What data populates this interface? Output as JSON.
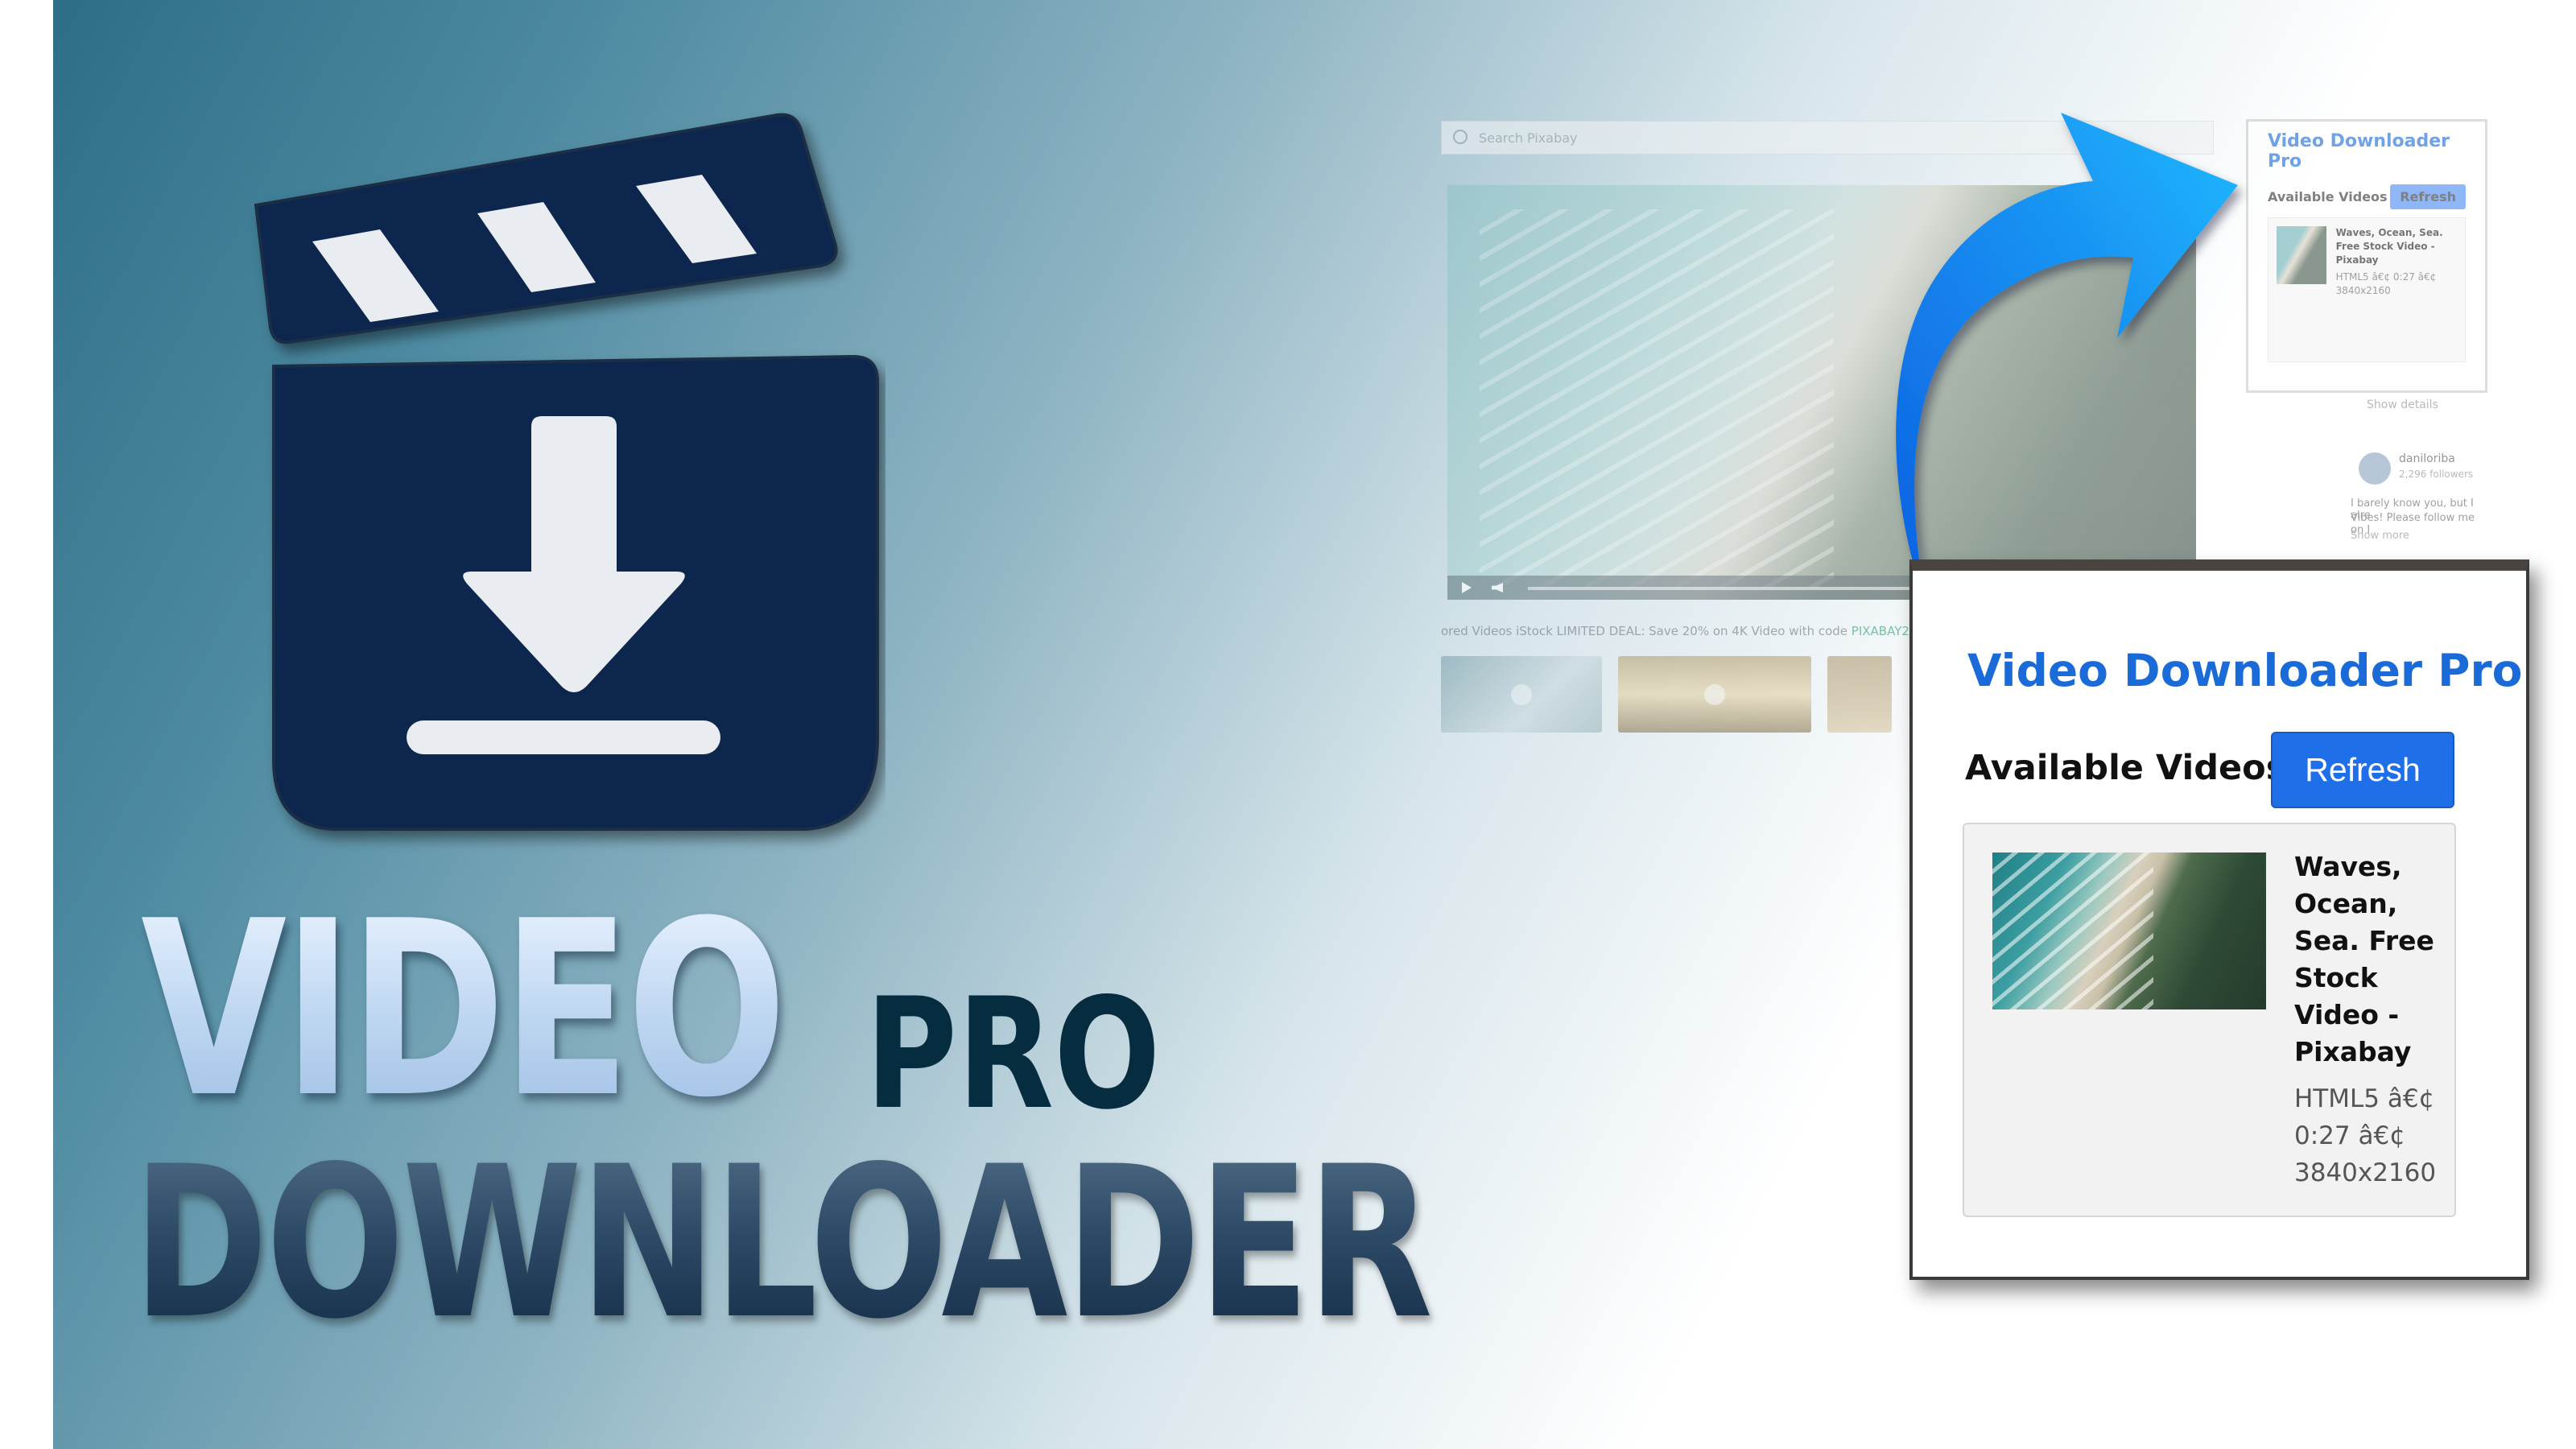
{
  "hero": {
    "title_line1": "VIDEO",
    "title_pro": "PRO",
    "title_line2": "DOWNLOADER"
  },
  "colors": {
    "accent_blue": "#1a6ad8",
    "button_blue": "#1f6fe8",
    "logo_navy": "#07264e",
    "pro_text": "#062c40"
  },
  "icons": {
    "logo": "clapperboard-download-icon",
    "arrow": "curved-arrow-icon"
  },
  "background_screenshot": {
    "search_placeholder": "Search Pixabay",
    "deal_text": "ored Videos iStock LIMITED DEAL: Save 20% on 4K Video with code ",
    "deal_code": "PIXABAY20",
    "show_details": "Show details",
    "username": "daniloriba",
    "followers": "2,296 followers",
    "comment": "I barely know you, but I alre",
    "comment2": "Vibes! Please follow me on I",
    "show_more": "Show more",
    "mini_popup": {
      "title": "Video Downloader Pro",
      "section": "Available Videos",
      "refresh": "Refresh",
      "video_title": "Waves, Ocean, Sea. Free Stock Video - Pixabay",
      "video_meta": "HTML5 â€¢ 0:27 â€¢ 3840x2160"
    }
  },
  "popup": {
    "title": "Video Downloader Pro",
    "section_label": "Available Videos",
    "refresh_label": "Refresh",
    "video": {
      "title": "Waves, Ocean, Sea. Free Stock Video - Pixabay",
      "meta": "HTML5 â€¢ 0:27 â€¢ 3840x2160"
    }
  }
}
